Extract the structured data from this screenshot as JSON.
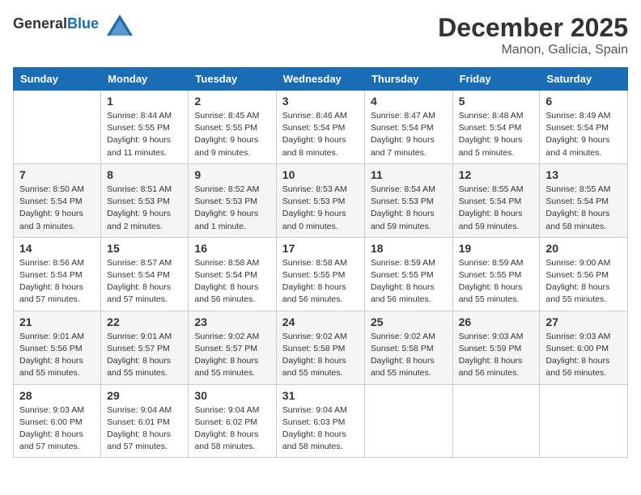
{
  "header": {
    "logo_general": "General",
    "logo_blue": "Blue",
    "month": "December 2025",
    "location": "Manon, Galicia, Spain"
  },
  "weekdays": [
    "Sunday",
    "Monday",
    "Tuesday",
    "Wednesday",
    "Thursday",
    "Friday",
    "Saturday"
  ],
  "weeks": [
    [
      {
        "day": "",
        "sunrise": "",
        "sunset": "",
        "daylight": ""
      },
      {
        "day": "1",
        "sunrise": "Sunrise: 8:44 AM",
        "sunset": "Sunset: 5:55 PM",
        "daylight": "Daylight: 9 hours and 11 minutes."
      },
      {
        "day": "2",
        "sunrise": "Sunrise: 8:45 AM",
        "sunset": "Sunset: 5:55 PM",
        "daylight": "Daylight: 9 hours and 9 minutes."
      },
      {
        "day": "3",
        "sunrise": "Sunrise: 8:46 AM",
        "sunset": "Sunset: 5:54 PM",
        "daylight": "Daylight: 9 hours and 8 minutes."
      },
      {
        "day": "4",
        "sunrise": "Sunrise: 8:47 AM",
        "sunset": "Sunset: 5:54 PM",
        "daylight": "Daylight: 9 hours and 7 minutes."
      },
      {
        "day": "5",
        "sunrise": "Sunrise: 8:48 AM",
        "sunset": "Sunset: 5:54 PM",
        "daylight": "Daylight: 9 hours and 5 minutes."
      },
      {
        "day": "6",
        "sunrise": "Sunrise: 8:49 AM",
        "sunset": "Sunset: 5:54 PM",
        "daylight": "Daylight: 9 hours and 4 minutes."
      }
    ],
    [
      {
        "day": "7",
        "sunrise": "Sunrise: 8:50 AM",
        "sunset": "Sunset: 5:54 PM",
        "daylight": "Daylight: 9 hours and 3 minutes."
      },
      {
        "day": "8",
        "sunrise": "Sunrise: 8:51 AM",
        "sunset": "Sunset: 5:53 PM",
        "daylight": "Daylight: 9 hours and 2 minutes."
      },
      {
        "day": "9",
        "sunrise": "Sunrise: 8:52 AM",
        "sunset": "Sunset: 5:53 PM",
        "daylight": "Daylight: 9 hours and 1 minute."
      },
      {
        "day": "10",
        "sunrise": "Sunrise: 8:53 AM",
        "sunset": "Sunset: 5:53 PM",
        "daylight": "Daylight: 9 hours and 0 minutes."
      },
      {
        "day": "11",
        "sunrise": "Sunrise: 8:54 AM",
        "sunset": "Sunset: 5:53 PM",
        "daylight": "Daylight: 8 hours and 59 minutes."
      },
      {
        "day": "12",
        "sunrise": "Sunrise: 8:55 AM",
        "sunset": "Sunset: 5:54 PM",
        "daylight": "Daylight: 8 hours and 59 minutes."
      },
      {
        "day": "13",
        "sunrise": "Sunrise: 8:55 AM",
        "sunset": "Sunset: 5:54 PM",
        "daylight": "Daylight: 8 hours and 58 minutes."
      }
    ],
    [
      {
        "day": "14",
        "sunrise": "Sunrise: 8:56 AM",
        "sunset": "Sunset: 5:54 PM",
        "daylight": "Daylight: 8 hours and 57 minutes."
      },
      {
        "day": "15",
        "sunrise": "Sunrise: 8:57 AM",
        "sunset": "Sunset: 5:54 PM",
        "daylight": "Daylight: 8 hours and 57 minutes."
      },
      {
        "day": "16",
        "sunrise": "Sunrise: 8:58 AM",
        "sunset": "Sunset: 5:54 PM",
        "daylight": "Daylight: 8 hours and 56 minutes."
      },
      {
        "day": "17",
        "sunrise": "Sunrise: 8:58 AM",
        "sunset": "Sunset: 5:55 PM",
        "daylight": "Daylight: 8 hours and 56 minutes."
      },
      {
        "day": "18",
        "sunrise": "Sunrise: 8:59 AM",
        "sunset": "Sunset: 5:55 PM",
        "daylight": "Daylight: 8 hours and 56 minutes."
      },
      {
        "day": "19",
        "sunrise": "Sunrise: 8:59 AM",
        "sunset": "Sunset: 5:55 PM",
        "daylight": "Daylight: 8 hours and 55 minutes."
      },
      {
        "day": "20",
        "sunrise": "Sunrise: 9:00 AM",
        "sunset": "Sunset: 5:56 PM",
        "daylight": "Daylight: 8 hours and 55 minutes."
      }
    ],
    [
      {
        "day": "21",
        "sunrise": "Sunrise: 9:01 AM",
        "sunset": "Sunset: 5:56 PM",
        "daylight": "Daylight: 8 hours and 55 minutes."
      },
      {
        "day": "22",
        "sunrise": "Sunrise: 9:01 AM",
        "sunset": "Sunset: 5:57 PM",
        "daylight": "Daylight: 8 hours and 55 minutes."
      },
      {
        "day": "23",
        "sunrise": "Sunrise: 9:02 AM",
        "sunset": "Sunset: 5:57 PM",
        "daylight": "Daylight: 8 hours and 55 minutes."
      },
      {
        "day": "24",
        "sunrise": "Sunrise: 9:02 AM",
        "sunset": "Sunset: 5:58 PM",
        "daylight": "Daylight: 8 hours and 55 minutes."
      },
      {
        "day": "25",
        "sunrise": "Sunrise: 9:02 AM",
        "sunset": "Sunset: 5:58 PM",
        "daylight": "Daylight: 8 hours and 55 minutes."
      },
      {
        "day": "26",
        "sunrise": "Sunrise: 9:03 AM",
        "sunset": "Sunset: 5:59 PM",
        "daylight": "Daylight: 8 hours and 56 minutes."
      },
      {
        "day": "27",
        "sunrise": "Sunrise: 9:03 AM",
        "sunset": "Sunset: 6:00 PM",
        "daylight": "Daylight: 8 hours and 56 minutes."
      }
    ],
    [
      {
        "day": "28",
        "sunrise": "Sunrise: 9:03 AM",
        "sunset": "Sunset: 6:00 PM",
        "daylight": "Daylight: 8 hours and 57 minutes."
      },
      {
        "day": "29",
        "sunrise": "Sunrise: 9:04 AM",
        "sunset": "Sunset: 6:01 PM",
        "daylight": "Daylight: 8 hours and 57 minutes."
      },
      {
        "day": "30",
        "sunrise": "Sunrise: 9:04 AM",
        "sunset": "Sunset: 6:02 PM",
        "daylight": "Daylight: 8 hours and 58 minutes."
      },
      {
        "day": "31",
        "sunrise": "Sunrise: 9:04 AM",
        "sunset": "Sunset: 6:03 PM",
        "daylight": "Daylight: 8 hours and 58 minutes."
      },
      {
        "day": "",
        "sunrise": "",
        "sunset": "",
        "daylight": ""
      },
      {
        "day": "",
        "sunrise": "",
        "sunset": "",
        "daylight": ""
      },
      {
        "day": "",
        "sunrise": "",
        "sunset": "",
        "daylight": ""
      }
    ]
  ]
}
